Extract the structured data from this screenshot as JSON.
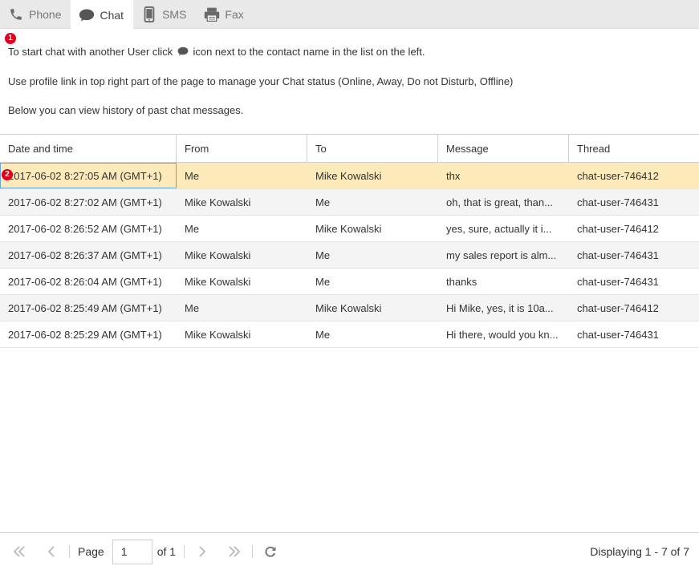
{
  "tabs": [
    {
      "label": "Phone",
      "icon": "phone-icon",
      "active": false
    },
    {
      "label": "Chat",
      "icon": "chat-bubble-icon",
      "active": true
    },
    {
      "label": "SMS",
      "icon": "mobile-phone-icon",
      "active": false
    },
    {
      "label": "Fax",
      "icon": "fax-icon",
      "active": false
    }
  ],
  "info": {
    "line1_before": "To start chat with another User click",
    "line1_after": "icon next to the contact name in the list on the left.",
    "line2": "Use profile link in top right part of the page to manage your Chat status (Online, Away, Do not Disturb, Offline)",
    "line3": "Below you can view history of past chat messages."
  },
  "badges": {
    "one": "1",
    "two": "2"
  },
  "grid": {
    "columns": [
      "Date and time",
      "From",
      "To",
      "Message",
      "Thread"
    ],
    "rows": [
      [
        "2017-06-02 8:27:05 AM (GMT+1)",
        "Me",
        "Mike Kowalski",
        "thx",
        "chat-user-746412"
      ],
      [
        "2017-06-02 8:27:02 AM (GMT+1)",
        "Mike Kowalski",
        "Me",
        "oh, that is great, than...",
        "chat-user-746431"
      ],
      [
        "2017-06-02 8:26:52 AM (GMT+1)",
        "Me",
        "Mike Kowalski",
        "yes, sure, actually it i...",
        "chat-user-746412"
      ],
      [
        "2017-06-02 8:26:37 AM (GMT+1)",
        "Mike Kowalski",
        "Me",
        "my sales report is alm...",
        "chat-user-746431"
      ],
      [
        "2017-06-02 8:26:04 AM (GMT+1)",
        "Mike Kowalski",
        "Me",
        "thanks",
        "chat-user-746431"
      ],
      [
        "2017-06-02 8:25:49 AM (GMT+1)",
        "Me",
        "Mike Kowalski",
        "Hi Mike, yes, it is 10a...",
        "chat-user-746412"
      ],
      [
        "2017-06-02 8:25:29 AM (GMT+1)",
        "Mike Kowalski",
        "Me",
        "Hi there, would you kn...",
        "chat-user-746431"
      ]
    ],
    "selected_row": 0
  },
  "pager": {
    "page_label": "Page",
    "page_value": "1",
    "of_label": "of 1",
    "displaying": "Displaying 1 - 7 of 7"
  },
  "colors": {
    "selected_row": "#fdeaba",
    "alt_row": "#f4f4f4",
    "badge": "#e0001a",
    "tabbar": "#e9e9e9"
  }
}
